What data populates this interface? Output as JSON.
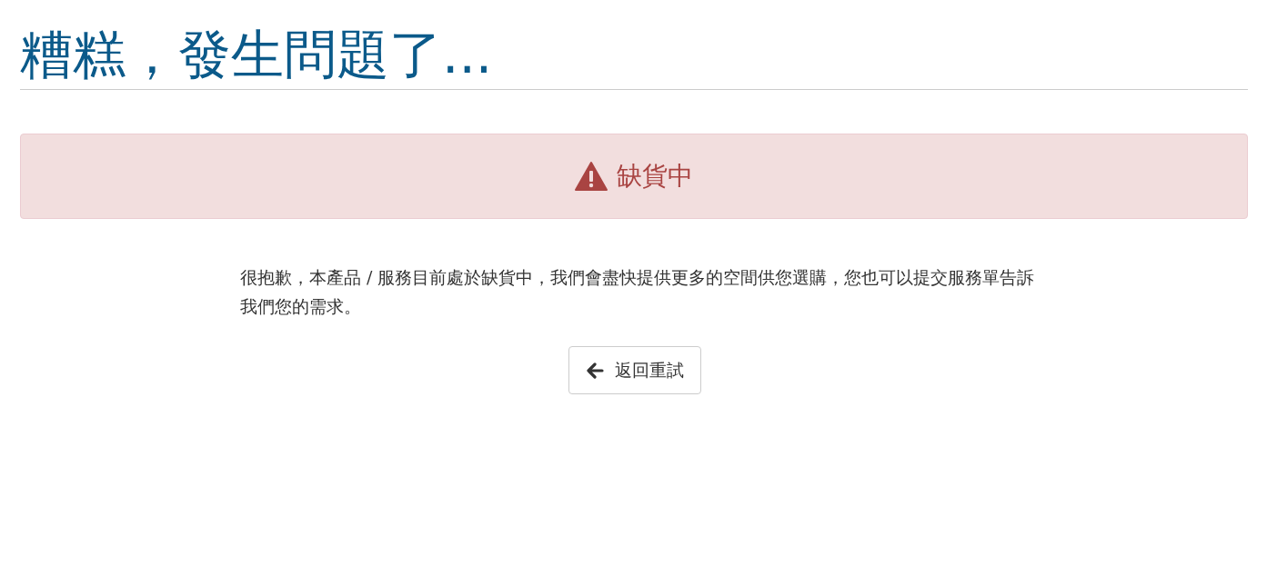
{
  "title": "糟糕，發生問題了...",
  "alert": {
    "text": "缺貨中"
  },
  "message": "很抱歉，本產品 / 服務目前處於缺貨中，我們會盡快提供更多的空間供您選購，您也可以提交服務單告訴我們您的需求。",
  "button": {
    "label": "返回重試"
  }
}
